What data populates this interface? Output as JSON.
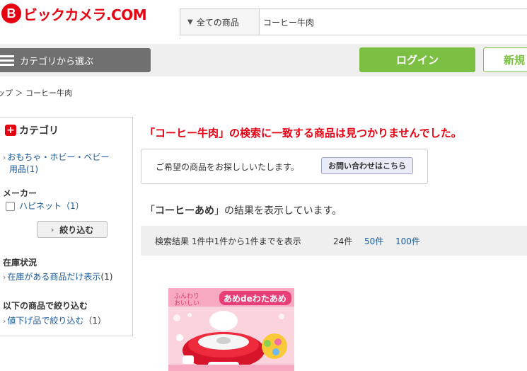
{
  "header": {
    "logo_mark": "B",
    "logo_text": "ビックカメラ.COM",
    "search_category": "全ての商品",
    "search_value": "コーヒー牛肉"
  },
  "nav": {
    "category_button": "カテゴリから選ぶ",
    "login": "ログイン",
    "signup": "新規"
  },
  "breadcrumb": {
    "text": "ップ ＞ コーヒー牛肉"
  },
  "sidebar": {
    "category_title": "カテゴリ",
    "category_link_line1": "おもちゃ・ホビー・ベビー",
    "category_link_line2": "用品(1)",
    "maker_title": "メーカー",
    "maker_item": "ハピネット（1）",
    "narrow_button": "絞り込む",
    "stock_title": "在庫状況",
    "stock_link": "在庫がある商品だけ表示",
    "stock_count": "(1)",
    "filter_title": "以下の商品で絞り込む",
    "filter_link": "値下げ品で絞り込む",
    "filter_count": "（1）"
  },
  "main": {
    "not_found": "「コーヒー牛肉」の検索に一致する商品は見つかりませんでした。",
    "help_text": "ご希望の商品をお探ししいたします。",
    "help_button": "お問い合わせはこちら",
    "result_prefix": "「",
    "result_keyword": "コーヒーあめ",
    "result_suffix": "」の結果を表示しています。",
    "results_count": "検索結果 1件中1件から1件までを表示",
    "per_page": [
      "24件",
      "50件",
      "100件"
    ]
  },
  "product": {
    "image_text_1": "ふんわり",
    "image_text_2": "おいしい",
    "image_title": "あめdeわたあめ"
  }
}
